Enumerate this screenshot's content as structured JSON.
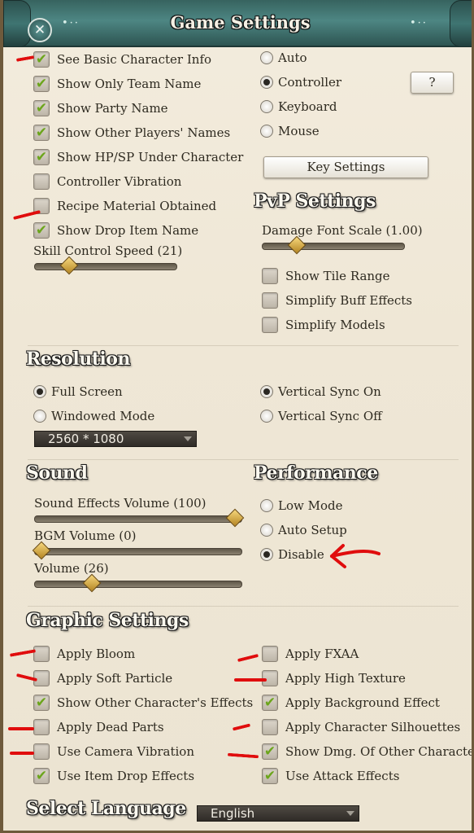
{
  "title": "Game Settings",
  "title_decoration": "•··",
  "close_icon": "close-icon",
  "general_left": [
    {
      "label": "See Basic Character Info",
      "checked": true
    },
    {
      "label": "Show Only Team Name",
      "checked": true
    },
    {
      "label": "Show Party Name",
      "checked": true
    },
    {
      "label": "Show Other Players' Names",
      "checked": true
    },
    {
      "label": "Show HP/SP Under Character",
      "checked": true
    },
    {
      "label": "Controller Vibration",
      "checked": false
    },
    {
      "label": "Recipe Material Obtained",
      "checked": false
    },
    {
      "label": "Show Drop Item Name",
      "checked": true
    }
  ],
  "skill_speed": {
    "label": "Skill Control Speed (21)",
    "value": 21,
    "max": 100
  },
  "input_modes": [
    {
      "label": "Auto",
      "selected": false
    },
    {
      "label": "Controller",
      "selected": true
    },
    {
      "label": "Keyboard",
      "selected": false
    },
    {
      "label": "Mouse",
      "selected": false
    }
  ],
  "help_button": "?",
  "key_settings_button": "Key Settings",
  "pvp": {
    "heading": "PvP Settings",
    "damage_font": {
      "label": "Damage Font Scale (1.00)",
      "value": 1.0
    },
    "options": [
      {
        "label": "Show Tile Range",
        "checked": false
      },
      {
        "label": "Simplify Buff Effects",
        "checked": false
      },
      {
        "label": "Simplify Models",
        "checked": false
      }
    ]
  },
  "resolution": {
    "heading": "Resolution",
    "modes": [
      {
        "label": "Full Screen",
        "selected": true
      },
      {
        "label": "Windowed Mode",
        "selected": false
      }
    ],
    "vsync": [
      {
        "label": "Vertical Sync On",
        "selected": true
      },
      {
        "label": "Vertical Sync Off",
        "selected": false
      }
    ],
    "selected_resolution": "2560 * 1080"
  },
  "sound": {
    "heading": "Sound",
    "sliders": [
      {
        "label": "Sound Effects Volume (100)",
        "value": 100
      },
      {
        "label": "BGM Volume (0)",
        "value": 0
      },
      {
        "label": "Volume (26)",
        "value": 26
      }
    ]
  },
  "performance": {
    "heading": "Performance",
    "modes": [
      {
        "label": "Low Mode",
        "selected": false
      },
      {
        "label": "Auto Setup",
        "selected": false
      },
      {
        "label": "Disable",
        "selected": true
      }
    ]
  },
  "graphic": {
    "heading": "Graphic Settings",
    "left": [
      {
        "label": "Apply Bloom",
        "checked": false
      },
      {
        "label": "Apply Soft Particle",
        "checked": false
      },
      {
        "label": "Show Other Character's Effects",
        "checked": true
      },
      {
        "label": "Apply Dead Parts",
        "checked": false
      },
      {
        "label": "Use Camera Vibration",
        "checked": false
      },
      {
        "label": "Use Item Drop Effects",
        "checked": true
      }
    ],
    "right": [
      {
        "label": "Apply FXAA",
        "checked": false
      },
      {
        "label": "Apply High Texture",
        "checked": false
      },
      {
        "label": "Apply Background Effect",
        "checked": true
      },
      {
        "label": "Apply Character Silhouettes",
        "checked": false
      },
      {
        "label": "Show Dmg. Of Other Characters",
        "checked": true
      },
      {
        "label": "Use Attack Effects",
        "checked": true
      }
    ]
  },
  "language": {
    "heading": "Select Language",
    "selected": "English"
  },
  "check_glyph": "✔",
  "annotation_color": "#e00d0d"
}
